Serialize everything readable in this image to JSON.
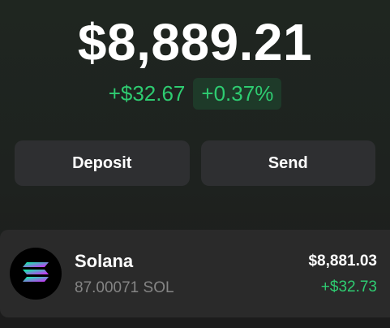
{
  "balance": "$8,889.21",
  "change": {
    "absolute": "+$32.67",
    "percent": "+0.37%"
  },
  "actions": {
    "deposit_label": "Deposit",
    "send_label": "Send"
  },
  "token": {
    "icon": "solana-logo-icon",
    "name": "Solana",
    "amount": "87.00071 SOL",
    "value": "$8,881.03",
    "change": "+$32.73"
  },
  "colors": {
    "positive": "#2ecc71",
    "button_bg": "#2e2f31",
    "card_bg": "#2a2a2a"
  }
}
